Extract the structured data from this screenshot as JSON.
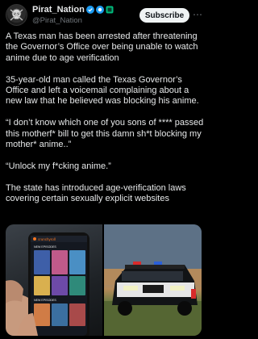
{
  "author": {
    "display_name": "Pirat_Nation",
    "handle": "@Pirat_Nation"
  },
  "actions": {
    "subscribe_label": "Subscribe",
    "more_label": "⋯"
  },
  "post": {
    "paragraphs": [
      "A Texas man has been arrested after threatening the Governor’s Office over being unable to watch anime due to age verification",
      "35-year-old man called the Texas Governor’s Office and left a voicemail complaining about a new law that he believed was blocking his anime.",
      "“I don’t know which one of you sons of **** passed this motherf* bill to get this damn sh*t blocking my mother* anime..”",
      "“Unlock my f*cking anime.”",
      "The state has introduced age-verification laws covering certain sexually explicit websites"
    ]
  },
  "media": {
    "left_image": {
      "app_header": "crunchyroll",
      "section_1": "NEW EPISODES",
      "section_2": "NEW EPISODES"
    },
    "right_image": {}
  },
  "colors": {
    "background": "#000000",
    "text": "#e7e9ea",
    "secondary_text": "#71767b",
    "verified_blue": "#1d9bf0",
    "badge_green": "#00ba7c",
    "crunchyroll_orange": "#f47521"
  }
}
